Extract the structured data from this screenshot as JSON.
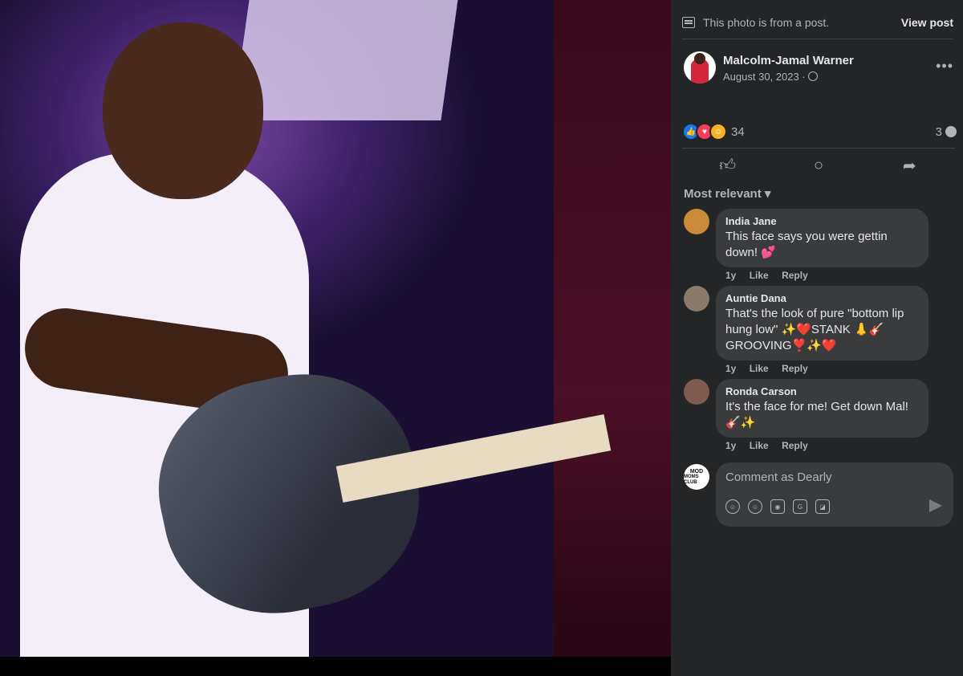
{
  "post_notice": {
    "text": "This photo is from a post.",
    "view_post": "View post"
  },
  "author": {
    "name": "Malcolm-Jamal Warner",
    "date": "August 30, 2023 ·"
  },
  "reactions": {
    "count": "34",
    "comments": "3"
  },
  "sort_label": "Most relevant",
  "comments": [
    {
      "name": "India Jane",
      "text": "This face says you were gettin down! 💕",
      "time": "1y",
      "like": "Like",
      "reply": "Reply"
    },
    {
      "name": "Auntie Dana",
      "text": "That's the look of pure \"bottom lip hung low\" ✨❤️STANK 👃🎸 GROOVING❣️✨❤️",
      "time": "1y",
      "like": "Like",
      "reply": "Reply"
    },
    {
      "name": "Ronda Carson",
      "text": "It's the face for me! Get down Mal! 🎸✨",
      "time": "1y",
      "like": "Like",
      "reply": "Reply"
    }
  ],
  "composer": {
    "placeholder": "Comment as Dearly",
    "avatar_line1": "MOD",
    "avatar_line2": "MOMS CLUB"
  },
  "colors": {
    "panel_bg": "#242526",
    "bubble_bg": "#3a3b3c",
    "like_blue": "#1877f2",
    "love_red": "#f33e58"
  }
}
